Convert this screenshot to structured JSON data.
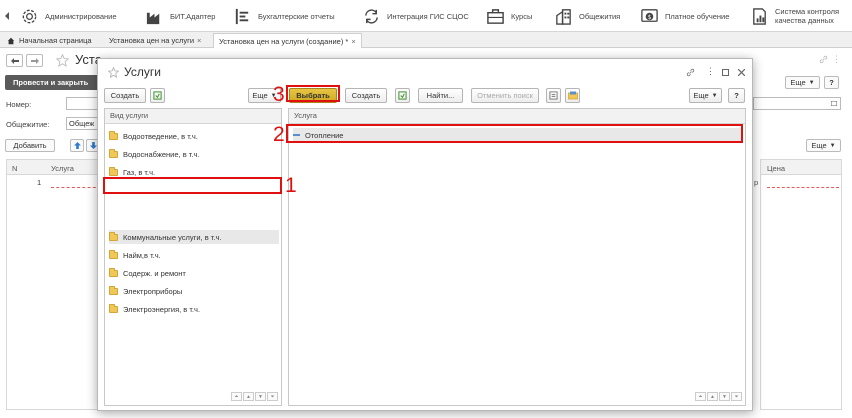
{
  "sections": [
    {
      "label": "Администрирование",
      "icon": "gear-icon"
    },
    {
      "label": "БИТ.Адаптер",
      "icon": "factory-icon"
    },
    {
      "label": "Бухгалтерские отчеты",
      "icon": "report-icon"
    },
    {
      "label": "Интеграция ГИС СЦОС",
      "icon": "sync-icon"
    },
    {
      "label": "Курсы",
      "icon": "briefcase-icon"
    },
    {
      "label": "Общежития",
      "icon": "building-icon"
    },
    {
      "label": "Платное обучение",
      "icon": "money-icon"
    },
    {
      "label_line1": "Система контроля",
      "label_line2": "качества данных",
      "icon": "quality-icon"
    }
  ],
  "tabs": {
    "home": "Начальная страница",
    "tab1": "Установка цен на услуги",
    "tab2": "Установка цен на услуги (создание) *",
    "close_glyph": "×"
  },
  "background_form": {
    "title": "Уста",
    "post_and_close": "Провести и закрыть",
    "number_label": "Номер:",
    "dormitory_label": "Общежитие:",
    "dormitory_value": "Общеж",
    "add_button": "Добавить",
    "col_n": "N",
    "col_service": "Услуга",
    "row1_n": "1",
    "col_price": "Цена",
    "more": "Еще",
    "help": "?",
    "clipped_text": "р"
  },
  "modal": {
    "title": "Услуги",
    "left_toolbar": {
      "create": "Создать",
      "more": "Еще"
    },
    "right_toolbar": {
      "select": "Выбрать",
      "create": "Создать",
      "find": "Найти...",
      "cancel_search": "Отменить поиск",
      "more": "Еще",
      "help": "?"
    },
    "left_panel": {
      "header": "Вид услуги",
      "items": [
        "Водоотведение, в т.ч.",
        "Водоснабжение, в т.ч.",
        "Газ, в т.ч.",
        "Коммунальные услуги, в т.ч.",
        "Найм,в т.ч.",
        "Содерж. и ремонт",
        "Электроприборы",
        "Электроэнергия, в т.ч."
      ],
      "selected_index": 3
    },
    "right_panel": {
      "header": "Услуга",
      "items": [
        "Отопление"
      ]
    }
  },
  "annotations": {
    "n1": "1",
    "n2": "2",
    "n3": "3",
    "color": "#e01010"
  },
  "colors": {
    "primary_button": "#d9b22e",
    "dark_button": "#5a5a5a",
    "folder": "#f0c85a"
  }
}
